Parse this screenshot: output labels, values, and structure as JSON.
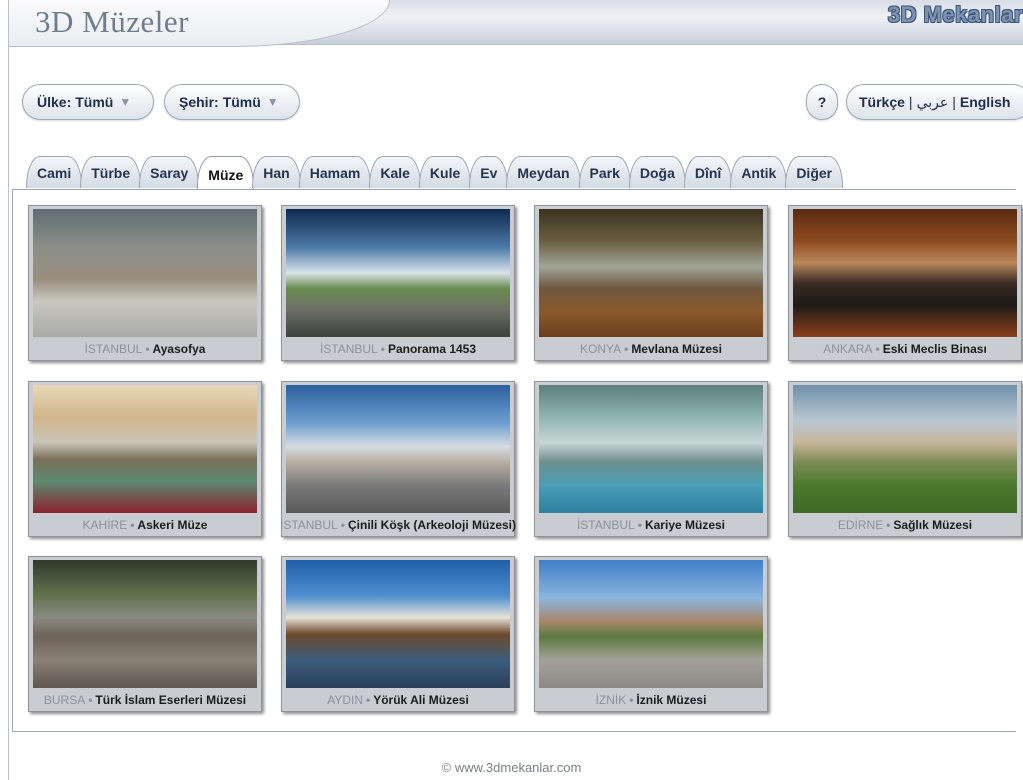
{
  "header": {
    "title": "3D Müzeler",
    "brand": "3D Mekanlar"
  },
  "filters": {
    "country_label": "Ülke:",
    "country_value": "Tümü",
    "city_label": "Şehir:",
    "city_value": "Tümü",
    "help": "?",
    "lang_tr": "Türkçe",
    "lang_ar": "عربي",
    "lang_en": "English",
    "lang_sep": "|"
  },
  "tabs": [
    {
      "label": "Cami"
    },
    {
      "label": "Türbe"
    },
    {
      "label": "Saray"
    },
    {
      "label": "Müze"
    },
    {
      "label": "Han"
    },
    {
      "label": "Hamam"
    },
    {
      "label": "Kale"
    },
    {
      "label": "Kule"
    },
    {
      "label": "Ev"
    },
    {
      "label": "Meydan"
    },
    {
      "label": "Park"
    },
    {
      "label": "Doğa"
    },
    {
      "label": "Dînî"
    },
    {
      "label": "Antik"
    },
    {
      "label": "Diğer"
    }
  ],
  "active_tab": "Müze",
  "museums": [
    {
      "city": "İSTANBUL",
      "name": "Ayasofya"
    },
    {
      "city": "İSTANBUL",
      "name": "Panorama 1453"
    },
    {
      "city": "KONYA",
      "name": "Mevlana Müzesi"
    },
    {
      "city": "ANKARA",
      "name": "Eski Meclis Binası"
    },
    {
      "city": "KAHİRE",
      "name": "Askeri Müze"
    },
    {
      "city": "İSTANBUL",
      "name": "Çinili Köşk (Arkeoloji Müzesi)"
    },
    {
      "city": "İSTANBUL",
      "name": "Kariye Müzesi"
    },
    {
      "city": "EDİRNE",
      "name": "Sağlık Müzesi"
    },
    {
      "city": "BURSA",
      "name": "Türk İslam Eserleri Müzesi"
    },
    {
      "city": "AYDIN",
      "name": "Yörük Ali Müzesi"
    },
    {
      "city": "İZNİK",
      "name": "İznik Müzesi"
    }
  ],
  "caption_sep": "•",
  "footer": "© www.3dmekanlar.com",
  "colors": {
    "brand_fill": "#7f94b4",
    "city_text": "#8a919a",
    "pill_text": "#1e2d4a"
  }
}
